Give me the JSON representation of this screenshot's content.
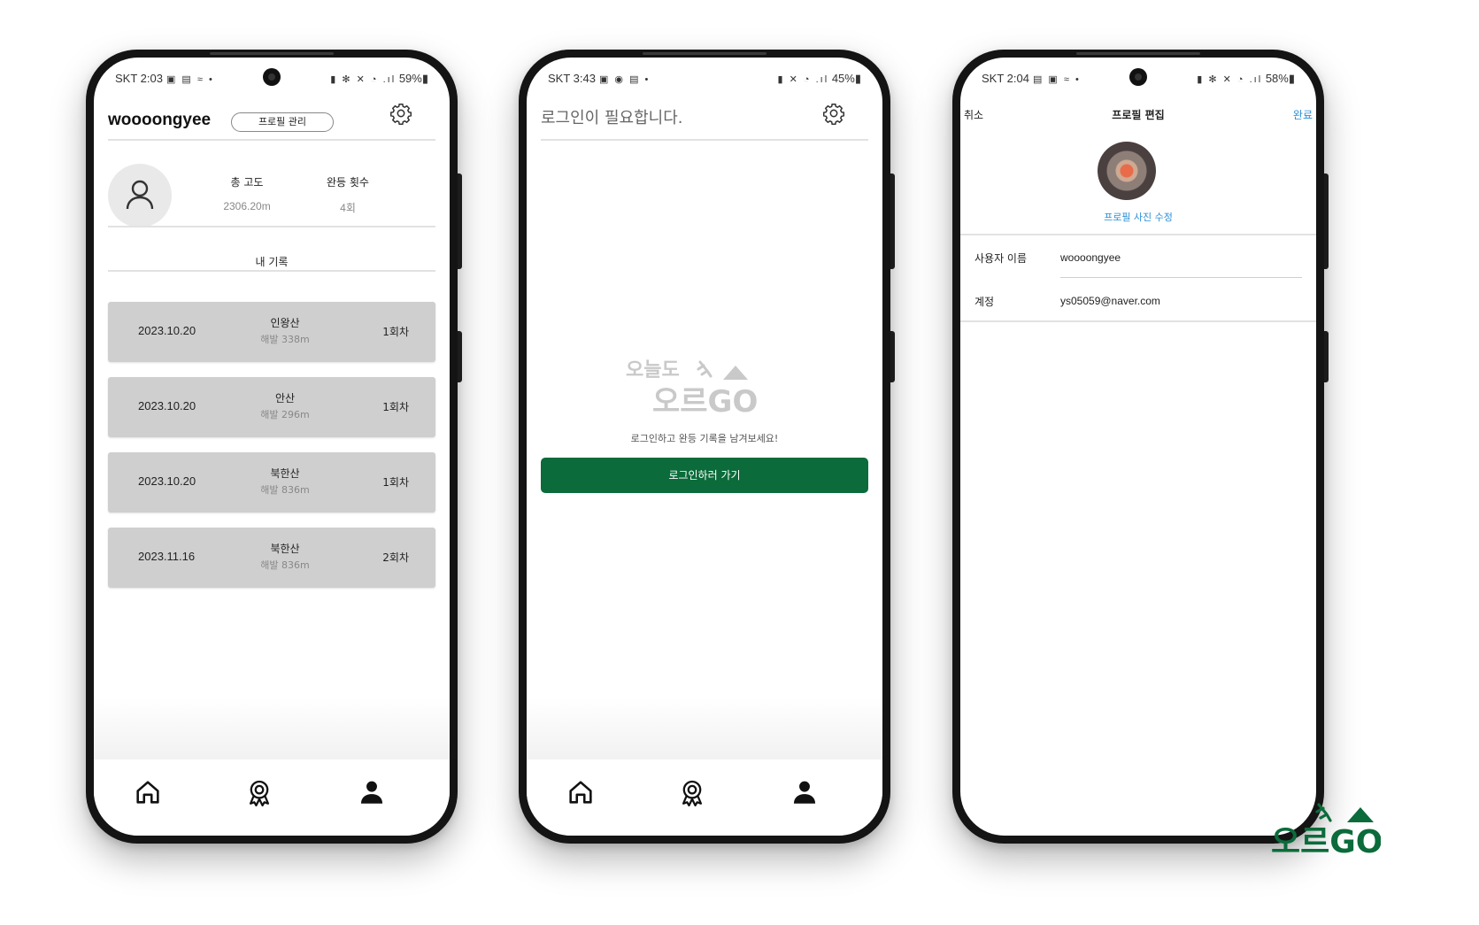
{
  "colors": {
    "brand_green": "#0b6b3a",
    "link_blue": "#2a8fd6",
    "card_gray": "#cfcfcf"
  },
  "screens": [
    {
      "status": {
        "time": "SKT 2:03",
        "battery": "59%"
      },
      "header": {
        "username": "woooongyee",
        "profile_button": "프로필 관리"
      },
      "stats": {
        "total_altitude_label": "총 고도",
        "total_altitude_value": "2306.20m",
        "climb_count_label": "완등 횟수",
        "climb_count_value": "4회"
      },
      "section_title": "내 기록",
      "records": [
        {
          "date": "2023.10.20",
          "mountain": "인왕산",
          "altitude": "해발 338m",
          "count": "1회차"
        },
        {
          "date": "2023.10.20",
          "mountain": "안산",
          "altitude": "해발 296m",
          "count": "1회차"
        },
        {
          "date": "2023.10.20",
          "mountain": "북한산",
          "altitude": "해발 836m",
          "count": "1회차"
        },
        {
          "date": "2023.11.16",
          "mountain": "북한산",
          "altitude": "해발 836m",
          "count": "2회차"
        }
      ],
      "tabs": [
        "home-icon",
        "award-icon",
        "person-icon"
      ]
    },
    {
      "status": {
        "time": "SKT 3:43",
        "battery": "45%"
      },
      "title": "로그인이 필요합니다.",
      "logo": {
        "line1": "오늘도",
        "line2": "오르GO"
      },
      "hint": "로그인하고 완등 기록을 남겨보세요!",
      "login_button": "로그인하러 가기"
    },
    {
      "status": {
        "time": "SKT 2:04",
        "battery": "58%"
      },
      "header": {
        "cancel": "취소",
        "title": "프로필 편집",
        "done": "완료"
      },
      "edit_photo": "프로필 사진 수정",
      "fields": [
        {
          "label": "사용자 이름",
          "value": "woooongyee"
        },
        {
          "label": "계정",
          "value": "ys05059@naver.com"
        }
      ]
    }
  ],
  "brand": {
    "name": "오르GO"
  }
}
